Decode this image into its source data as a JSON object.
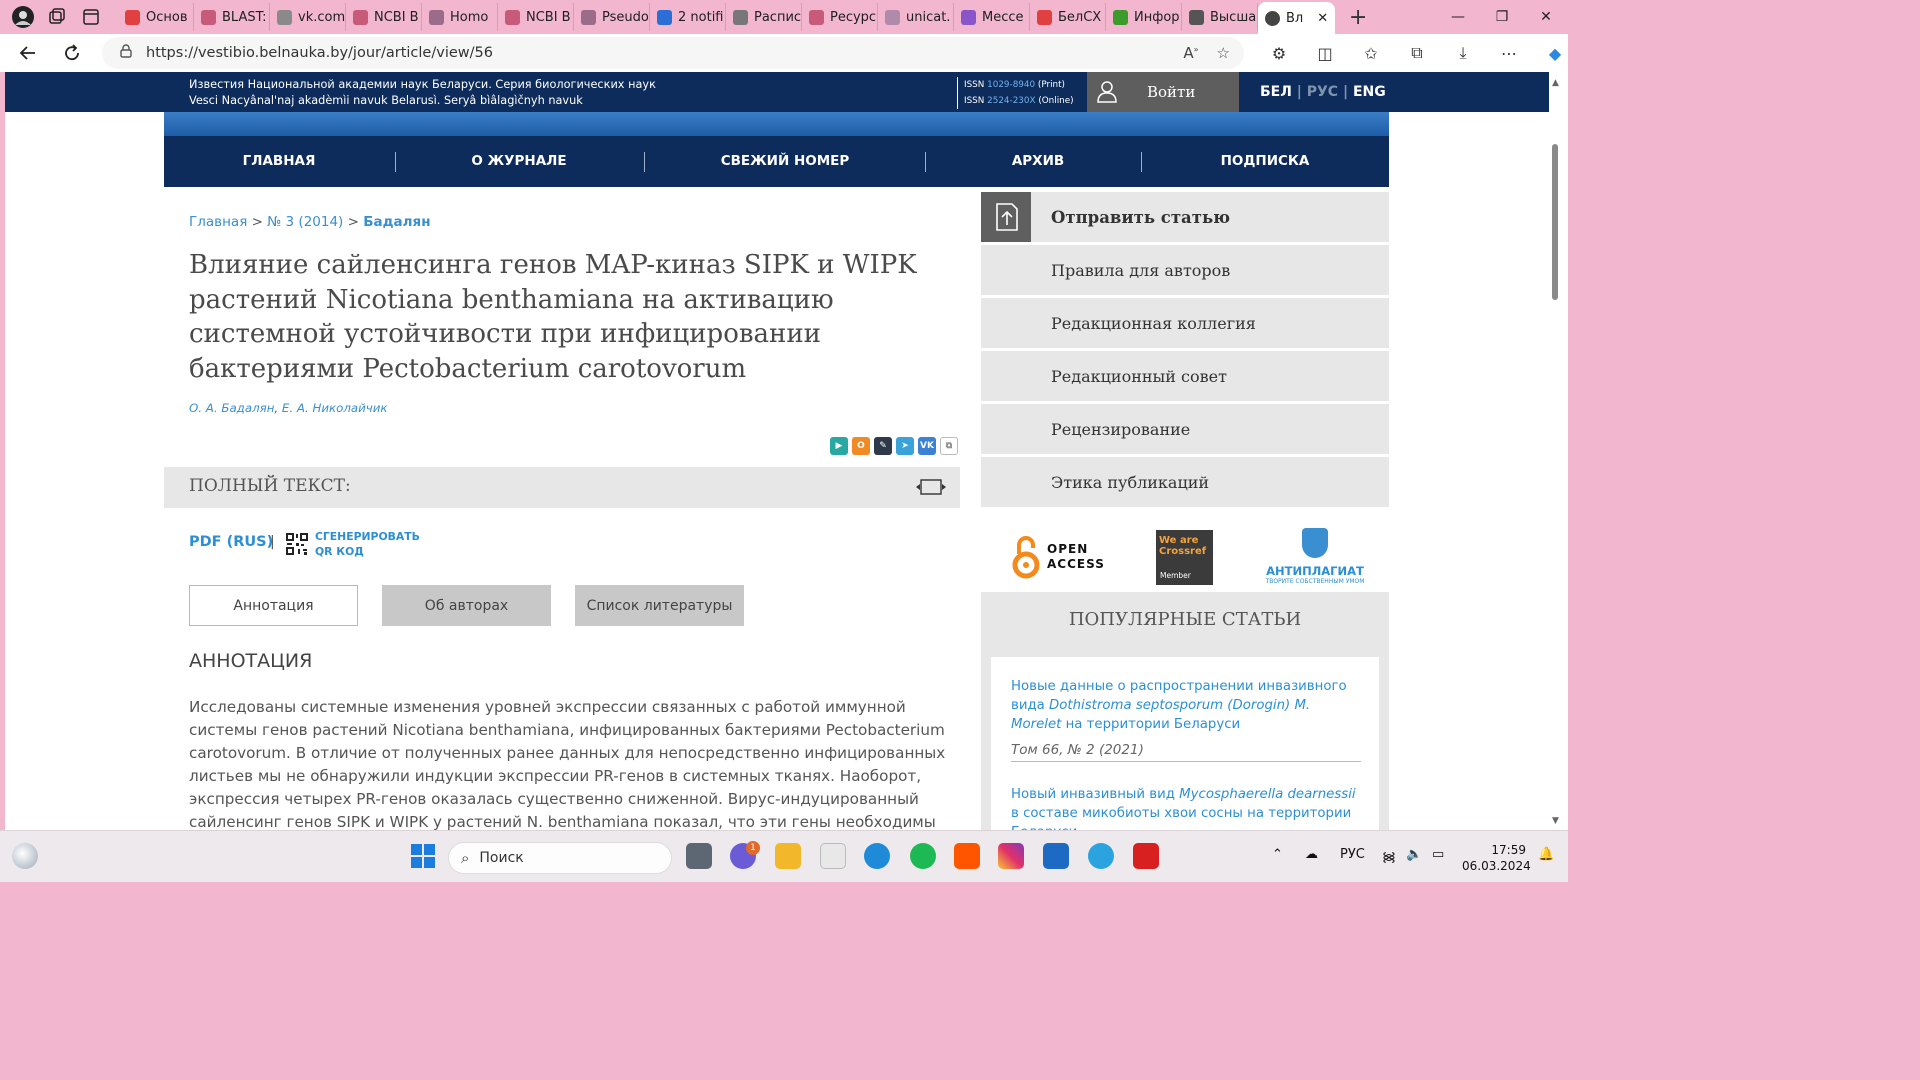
{
  "browser": {
    "tabs": [
      {
        "label": "Основ",
        "color": "#e04040"
      },
      {
        "label": "BLAST:",
        "color": "#c85a7a"
      },
      {
        "label": "vk.com",
        "color": "#8a8a8a"
      },
      {
        "label": "NCBI B",
        "color": "#c85a7a"
      },
      {
        "label": "Homo",
        "color": "#9b6b8a"
      },
      {
        "label": "NCBI B",
        "color": "#c85a7a"
      },
      {
        "label": "Pseudo",
        "color": "#9b6b8a"
      },
      {
        "label": "2 notifi",
        "color": "#2b6fd6"
      },
      {
        "label": "Распис",
        "color": "#777777"
      },
      {
        "label": "Ресурс",
        "color": "#c85a7a"
      },
      {
        "label": "unicat.",
        "color": "#b08aa8"
      },
      {
        "label": "Мессе",
        "color": "#8a55c8"
      },
      {
        "label": "БелСХ",
        "color": "#e04040"
      },
      {
        "label": "Инфор",
        "color": "#3b9b2b"
      },
      {
        "label": "Высша",
        "color": "#555555"
      }
    ],
    "active_tab": {
      "label": "Вл",
      "close": "✕"
    },
    "new_tab": "+",
    "window_controls": [
      "—",
      "❐",
      "✕"
    ],
    "url": "https://vestibio.belnauka.by/jour/article/view/56"
  },
  "header": {
    "journal_ru": "Известия Национальной академии наук Беларуси. Серия биологических наук",
    "journal_by": "Vesci Nacyânal'naj akadèmìi navuk Belarusì. Seryâ bìâlagìčnyh navuk",
    "issn_print_label": "ISSN ",
    "issn_print": "1029-8940",
    "issn_print_suffix": " (Print)",
    "issn_online_label": "ISSN ",
    "issn_online": "2524-230X",
    "issn_online_suffix": " (Online)",
    "login": "Войти",
    "lang_bel": "БЕЛ",
    "lang_rus": "РУС",
    "lang_eng": "ENG",
    "lang_sep": " | "
  },
  "nav": [
    "ГЛАВНАЯ",
    "О ЖУРНАЛЕ",
    "СВЕЖИЙ НОМЕР",
    "АРХИВ",
    "ПОДПИСКА"
  ],
  "breadcrumb": {
    "home": "Главная",
    "issue": "№ 3 (2014)",
    "current": "Бадалян",
    "sep": " > "
  },
  "article": {
    "title": "Влияние сайленсинга генов MAP-киназ SIPK и WIPK растений Nicotiana benthamiana на активацию системной устойчивости при инфицировании бактериями Pectobacterium carotovorum",
    "author1": "О. А. Бадалян",
    "author_sep": ", ",
    "author2": "Е. А. Николайчик"
  },
  "fulltext": {
    "label": "ПОЛНЫЙ ТЕКСТ:",
    "pdf": "PDF (RUS)",
    "sep": "|",
    "qr_line1": "СГЕНЕРИРОВАТЬ",
    "qr_line2": "QR КОД"
  },
  "tabs": [
    "Аннотация",
    "Об авторах",
    "Список литературы"
  ],
  "abstract": {
    "heading": "АННОТАЦИЯ",
    "text": "Исследованы системные изменения уровней экспрессии связанных с работой иммунной системы генов растений Nicotiana benthamiana, инфицированных бактериями Pectobacterium carotovorum. В отличие от полученных ранее данных для непосредственно инфицированных листьев мы не обнаружили индукции экспрессии PR-генов в системных тканях. Наоборот, экспрессия четырех PR-генов оказалась существенно сниженной. Вирус-индуцированный сайленсинг генов SIPK и WIPK у растений N. benthamiana показал, что эти гены необходимы для системной супрессии PR-генов в"
  },
  "sidebar": {
    "items": [
      "Отправить статью",
      "Правила для авторов",
      "Редакционная коллегия",
      "Редакционный совет",
      "Рецензирование",
      "Этика публикаций"
    ],
    "oa_line1": "OPEN",
    "oa_line2": "ACCESS",
    "crossref_line1": "We are",
    "crossref_line2": "Crossref",
    "crossref_member": "Member",
    "antiplagiat": "АНТИПЛАГИАТ",
    "antiplagiat_slogan": "ТВОРИТЕ СОБСТВЕННЫМ УМОМ",
    "popular_heading": "ПОПУЛЯРНЫЕ СТАТЬИ",
    "popular": [
      {
        "pre": "Новые данные о распространении инвазивного вида ",
        "italic": "Dothistroma septosporum (Dorogin) M. Morelet",
        "post": " на территории Беларуси",
        "meta": "Том 66, № 2 (2021)"
      },
      {
        "pre": "Новый инвазивный вид ",
        "italic": "Mycosphaerella dearnessii",
        "post": " в составе микобиоты хвои сосны на территории Беларуси",
        "meta": ""
      }
    ]
  },
  "taskbar": {
    "search": "Поиск",
    "badge": "1",
    "lang": "РУС",
    "time": "17:59",
    "date": "06.03.2024"
  },
  "colors": {
    "brand_dark": "#0d2c5c",
    "link": "#2c8fd5",
    "tab_strip": "#f3b6cf"
  }
}
